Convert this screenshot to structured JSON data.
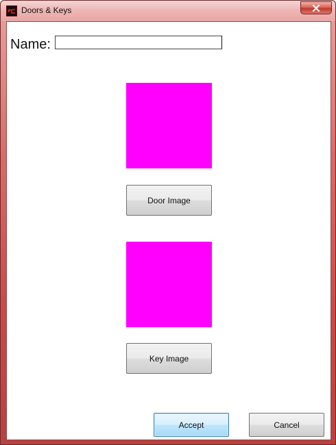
{
  "window": {
    "title": "Doors & Keys",
    "close_symbol": "X",
    "icon_name": "app-logo-icon"
  },
  "form": {
    "name_label": "Name:",
    "name_value": "",
    "name_placeholder": ""
  },
  "images": {
    "door_placeholder_color": "#ff00ff",
    "key_placeholder_color": "#ff00ff",
    "door_button_label": "Door Image",
    "key_button_label": "Key Image"
  },
  "actions": {
    "accept_label": "Accept",
    "cancel_label": "Cancel"
  }
}
